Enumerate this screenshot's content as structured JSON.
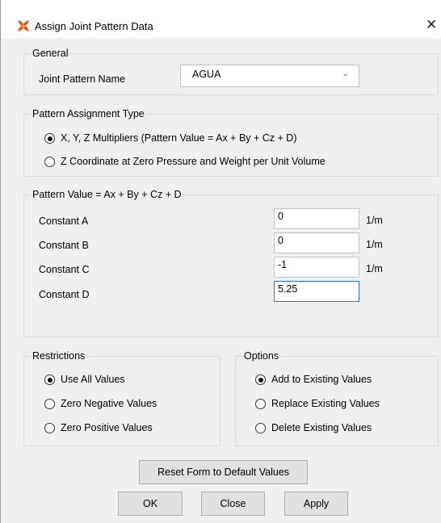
{
  "window": {
    "title": "Assign Joint Pattern Data",
    "close_glyph": "✕"
  },
  "general": {
    "legend": "General",
    "pattern_name_label": "Joint Pattern Name",
    "pattern_name_value": "AGUA",
    "dropdown_glyph": "⌄"
  },
  "assignment_type": {
    "legend": "Pattern Assignment Type",
    "options": [
      {
        "label": "X, Y, Z Multipliers  (Pattern Value = Ax + By + Cz + D)",
        "checked": true
      },
      {
        "label": "Z Coordinate at Zero Pressure and Weight per Unit Volume",
        "checked": false
      }
    ]
  },
  "pattern_value": {
    "legend": "Pattern Value = Ax + By + Cz + D",
    "constants": [
      {
        "label": "Constant A",
        "value": "0",
        "unit": "1/m"
      },
      {
        "label": "Constant B",
        "value": "0",
        "unit": "1/m"
      },
      {
        "label": "Constant C",
        "value": "-1",
        "unit": "1/m"
      },
      {
        "label": "Constant D",
        "value": "5.25",
        "unit": ""
      }
    ]
  },
  "restrictions": {
    "legend": "Restrictions",
    "options": [
      {
        "label": "Use All Values",
        "checked": true
      },
      {
        "label": "Zero Negative Values",
        "checked": false
      },
      {
        "label": "Zero Positive Values",
        "checked": false
      }
    ]
  },
  "options": {
    "legend": "Options",
    "options": [
      {
        "label": "Add to Existing Values",
        "checked": true
      },
      {
        "label": "Replace Existing Values",
        "checked": false
      },
      {
        "label": "Delete Existing Values",
        "checked": false
      }
    ]
  },
  "buttons": {
    "reset": "Reset Form to Default Values",
    "ok": "OK",
    "close": "Close",
    "apply": "Apply"
  }
}
